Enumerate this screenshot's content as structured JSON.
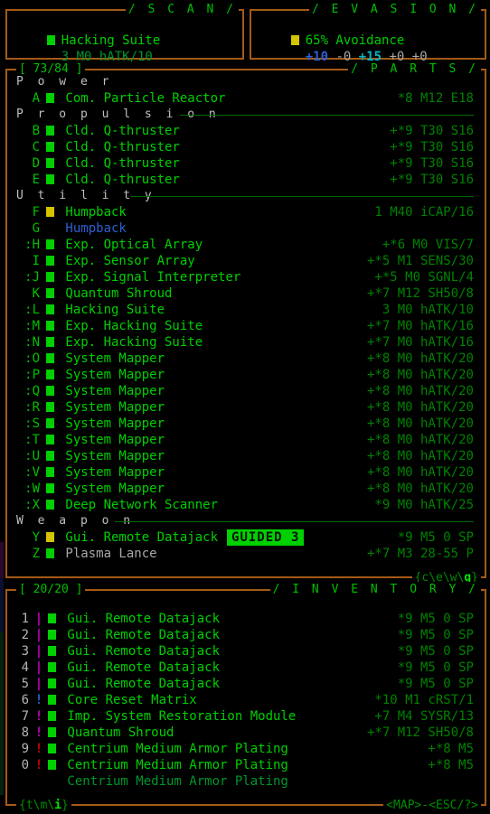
{
  "scan": {
    "title": "/ S C A N /",
    "item_name": "Hacking Suite",
    "item_stats": "3 M0 hATK/10",
    "marker": "green-square"
  },
  "evasion": {
    "title": "/ E V A S I O N /",
    "avoidance": "65% Avoidance",
    "marker": "yellow-square",
    "modifiers": [
      {
        "text": "+10",
        "color": "#2d5fd0"
      },
      {
        "text": "-0",
        "color": "#a8a8a8"
      },
      {
        "text": "+15",
        "color": "#00b8c8"
      },
      {
        "text": "+0",
        "color": "#a8a8a8"
      },
      {
        "text": "+0",
        "color": "#a8a8a8"
      }
    ]
  },
  "parts": {
    "title": "/ P A R T S /",
    "count_label": "[ 73/84 ]",
    "footer_right": "{c\\e\\w\\q}",
    "footer_right_hot": "q",
    "groups": [
      {
        "category": "P o w e r",
        "rule": false,
        "items": [
          {
            "key": "A",
            "mark": "■",
            "mark_color": "green",
            "name": "Com. Particle Reactor",
            "name_color": "green",
            "vals": "*8 M12 E18"
          }
        ]
      },
      {
        "category": "P r o p u l s i o n",
        "rule": true,
        "items": [
          {
            "key": "B",
            "mark": "■",
            "mark_color": "green",
            "name": "Cld. Q-thruster",
            "name_color": "green",
            "vals": "+*9 T30 S16"
          },
          {
            "key": "C",
            "mark": "■",
            "mark_color": "green",
            "name": "Cld. Q-thruster",
            "name_color": "green",
            "vals": "+*9 T30 S16"
          },
          {
            "key": "D",
            "mark": "■",
            "mark_color": "green",
            "name": "Cld. Q-thruster",
            "name_color": "green",
            "vals": "+*9 T30 S16"
          },
          {
            "key": "E",
            "mark": "■",
            "mark_color": "green",
            "name": "Cld. Q-thruster",
            "name_color": "green",
            "vals": "+*9 T30 S16"
          }
        ]
      },
      {
        "category": "U t i l i t y",
        "rule": true,
        "items": [
          {
            "key": "F",
            "mark": "■",
            "mark_color": "yellow",
            "name": "Humpback",
            "name_color": "green",
            "vals": "1 M40 iCAP/16"
          },
          {
            "key": "G",
            "mark": "",
            "mark_color": "none",
            "name": "Humpback",
            "name_color": "blue",
            "vals": ""
          },
          {
            "key": ":H",
            "mark": "■",
            "mark_color": "green",
            "name": "Exp. Optical Array",
            "name_color": "green",
            "vals": "+*6 M0 VIS/7"
          },
          {
            "key": "I",
            "mark": "■",
            "mark_color": "green",
            "name": "Exp. Sensor Array",
            "name_color": "green",
            "vals": "+*5 M1 SENS/30"
          },
          {
            "key": ":J",
            "mark": "■",
            "mark_color": "green",
            "name": "Exp. Signal Interpreter",
            "name_color": "green",
            "vals": "+*5 M0 SGNL/4"
          },
          {
            "key": "K",
            "mark": "■",
            "mark_color": "green",
            "name": "Quantum Shroud",
            "name_color": "green",
            "vals": "+*7 M12 SH50/8"
          },
          {
            "key": ":L",
            "mark": "■",
            "mark_color": "green",
            "name": "Hacking Suite",
            "name_color": "green",
            "vals": "3 M0 hATK/10"
          },
          {
            "key": ":M",
            "mark": "■",
            "mark_color": "green",
            "name": "Exp. Hacking Suite",
            "name_color": "green",
            "vals": "+*7 M0 hATK/16"
          },
          {
            "key": ":N",
            "mark": "■",
            "mark_color": "green",
            "name": "Exp. Hacking Suite",
            "name_color": "green",
            "vals": "+*7 M0 hATK/16"
          },
          {
            "key": ":O",
            "mark": "■",
            "mark_color": "green",
            "name": "System Mapper",
            "name_color": "green",
            "vals": "+*8 M0 hATK/20"
          },
          {
            "key": ":P",
            "mark": "■",
            "mark_color": "green",
            "name": "System Mapper",
            "name_color": "green",
            "vals": "+*8 M0 hATK/20"
          },
          {
            "key": ":Q",
            "mark": "■",
            "mark_color": "green",
            "name": "System Mapper",
            "name_color": "green",
            "vals": "+*8 M0 hATK/20"
          },
          {
            "key": ":R",
            "mark": "■",
            "mark_color": "green",
            "name": "System Mapper",
            "name_color": "green",
            "vals": "+*8 M0 hATK/20"
          },
          {
            "key": ":S",
            "mark": "■",
            "mark_color": "green",
            "name": "System Mapper",
            "name_color": "green",
            "vals": "+*8 M0 hATK/20"
          },
          {
            "key": ":T",
            "mark": "■",
            "mark_color": "green",
            "name": "System Mapper",
            "name_color": "green",
            "vals": "+*8 M0 hATK/20"
          },
          {
            "key": ":U",
            "mark": "■",
            "mark_color": "green",
            "name": "System Mapper",
            "name_color": "green",
            "vals": "+*8 M0 hATK/20"
          },
          {
            "key": ":V",
            "mark": "■",
            "mark_color": "green",
            "name": "System Mapper",
            "name_color": "green",
            "vals": "+*8 M0 hATK/20"
          },
          {
            "key": ":W",
            "mark": "■",
            "mark_color": "green",
            "name": "System Mapper",
            "name_color": "green",
            "vals": "+*8 M0 hATK/20"
          },
          {
            "key": ":X",
            "mark": "■",
            "mark_color": "green",
            "name": "Deep Network Scanner",
            "name_color": "green",
            "vals": "*9 M0 hATK/25"
          }
        ]
      },
      {
        "category": "W e a p o n",
        "rule": true,
        "items": [
          {
            "key": "Y",
            "mark": "■",
            "mark_color": "yellow",
            "name": "Gui. Remote Datajack",
            "name_color": "green",
            "badge": "GUIDED 3",
            "vals": "*9 M5 0 SP"
          },
          {
            "key": "Z",
            "mark": "■",
            "mark_color": "green",
            "name": "Plasma Lance",
            "name_color": "gray",
            "vals": "+*7 M3 28-55 P"
          }
        ]
      }
    ]
  },
  "inventory": {
    "title": "/ I N V E N T O R Y /",
    "count_label": "[ 20/20 ]",
    "footer_left": "{t\\m\\i}",
    "footer_left_hot": "i",
    "footer_map": "<MAP>",
    "footer_esc": "<ESC/?>",
    "items": [
      {
        "key": "1",
        "mark": "|",
        "mark_color": "magenta",
        "sq": "green",
        "name": "Gui. Remote Datajack",
        "name_color": "green",
        "vals": "*9 M5 0 SP"
      },
      {
        "key": "2",
        "mark": "|",
        "mark_color": "magenta",
        "sq": "green",
        "name": "Gui. Remote Datajack",
        "name_color": "green",
        "vals": "*9 M5 0 SP"
      },
      {
        "key": "3",
        "mark": "|",
        "mark_color": "magenta",
        "sq": "green",
        "name": "Gui. Remote Datajack",
        "name_color": "green",
        "vals": "*9 M5 0 SP"
      },
      {
        "key": "4",
        "mark": "|",
        "mark_color": "magenta",
        "sq": "green",
        "name": "Gui. Remote Datajack",
        "name_color": "green",
        "vals": "*9 M5 0 SP"
      },
      {
        "key": "5",
        "mark": "|",
        "mark_color": "magenta",
        "sq": "green",
        "name": "Gui. Remote Datajack",
        "name_color": "green",
        "vals": "*9 M5 0 SP"
      },
      {
        "key": "6",
        "mark": "!",
        "mark_color": "blue",
        "sq": "green",
        "name": "Core Reset Matrix",
        "name_color": "green",
        "vals": "*10 M1 cRST/1"
      },
      {
        "key": "7",
        "mark": "!",
        "mark_color": "magenta",
        "sq": "green",
        "name": "Imp. System Restoration Module",
        "name_color": "green",
        "vals": "+7 M4 SYSR/13"
      },
      {
        "key": "8",
        "mark": "!",
        "mark_color": "magenta",
        "sq": "green",
        "name": "Quantum Shroud",
        "name_color": "green",
        "vals": "+*7 M12 SH50/8"
      },
      {
        "key": "9",
        "mark": "!",
        "mark_color": "red",
        "sq": "green",
        "name": "Centrium Medium Armor Plating",
        "name_color": "green",
        "vals": "+*8 M5"
      },
      {
        "key": "0",
        "mark": "!",
        "mark_color": "red",
        "sq": "green",
        "name": "Centrium Medium Armor Plating",
        "name_color": "green",
        "vals": "+*8 M5"
      },
      {
        "key": "",
        "mark": "",
        "mark_color": "none",
        "sq": "none",
        "name": "Centrium Medium Armor Plating",
        "name_color": "dim",
        "vals": ""
      }
    ]
  },
  "colors": {
    "border": "#a45a17",
    "green": "#00d000",
    "dark_green": "#008200",
    "yellow": "#d4c400",
    "blue": "#2d5fd0",
    "magenta": "#c000c0",
    "red": "#d00000",
    "gray": "#a8a8a8"
  }
}
